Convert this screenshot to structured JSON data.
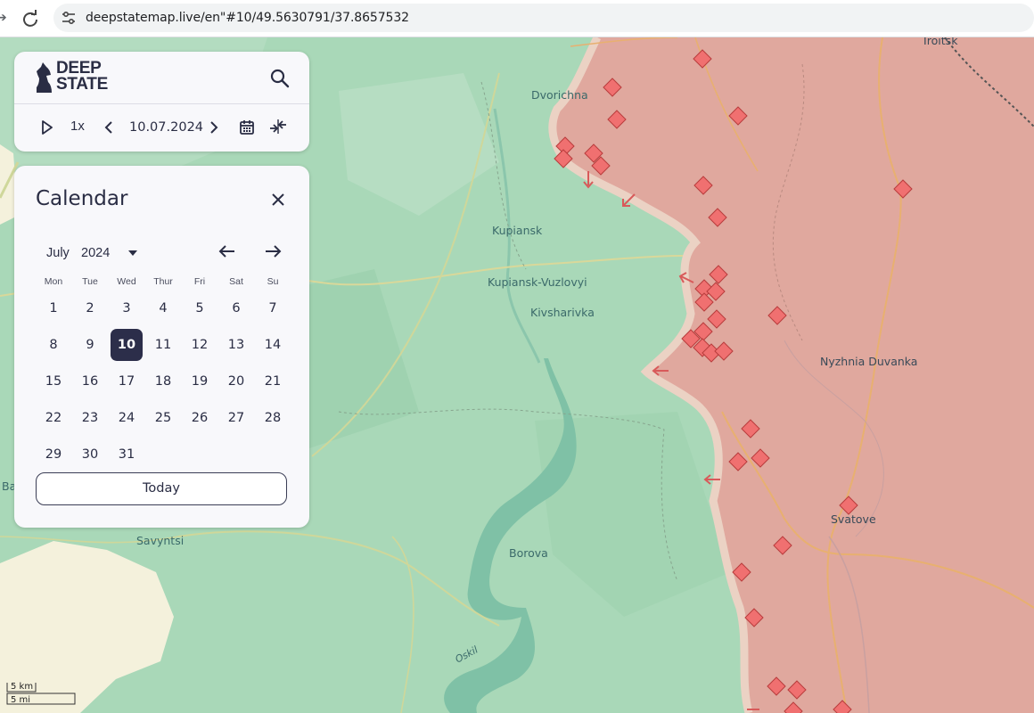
{
  "browser": {
    "url": "deepstatemap.live/en\"#10/49.5630791/37.8657532"
  },
  "header": {
    "logo_line1": "DEEP",
    "logo_line2": "STATE"
  },
  "timeline": {
    "speed": "1x",
    "date": "10.07.2024"
  },
  "calendar": {
    "title": "Calendar",
    "month": "July",
    "year": "2024",
    "weekdays": [
      "Mon",
      "Tue",
      "Wed",
      "Thur",
      "Fri",
      "Sat",
      "Su"
    ],
    "days": [
      "1",
      "2",
      "3",
      "4",
      "5",
      "6",
      "7",
      "8",
      "9",
      "10",
      "11",
      "12",
      "13",
      "14",
      "15",
      "16",
      "17",
      "18",
      "19",
      "20",
      "21",
      "22",
      "23",
      "24",
      "25",
      "26",
      "27",
      "28",
      "29",
      "30",
      "31"
    ],
    "selected_day": "10",
    "today_label": "Today"
  },
  "map": {
    "places": [
      "Troitsk",
      "Dvorichna",
      "Kupiansk",
      "Kupiansk-Vuzlovyi",
      "Kivsharivka",
      "Nyzhnia Duvanka",
      "Svatove",
      "Borova",
      "Savyntsi",
      "Oskil",
      "Ba"
    ],
    "scale_km": "5 km",
    "scale_mi": "5 mi",
    "colors": {
      "controlled": "#e0a89e",
      "land": "#a9d8b8",
      "marker": "#f07070"
    }
  }
}
